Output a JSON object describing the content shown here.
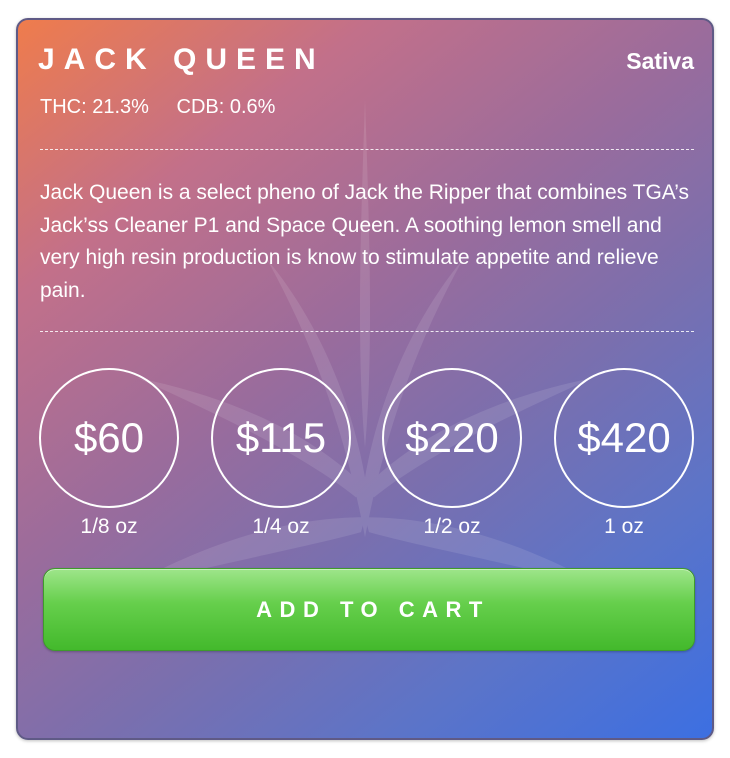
{
  "product": {
    "name": "JACK QUEEN",
    "type": "Sativa",
    "stats": [
      {
        "label": "THC:",
        "value": "21.3%"
      },
      {
        "label": "CDB:",
        "value": "0.6%"
      }
    ],
    "description": "Jack Queen is a select pheno of Jack the Ripper that combines TGA’s Jack’ss Cleaner P1 and Space Queen. A soothing lemon smell and very high resin production is know to stimulate appetite and relieve pain."
  },
  "prices": [
    {
      "price": "$60",
      "weight": "1/8 oz"
    },
    {
      "price": "$115",
      "weight": "1/4 oz"
    },
    {
      "price": "$220",
      "weight": "1/2 oz"
    },
    {
      "price": "$420",
      "weight": "1 oz"
    }
  ],
  "cart": {
    "label": "ADD TO CART"
  },
  "colors": {
    "gradient_start": "#ef7c4c",
    "gradient_mid": "#9a6c9c",
    "gradient_end": "#3c6fe2",
    "button_green": "#5ccb42",
    "text": "#ffffff"
  }
}
